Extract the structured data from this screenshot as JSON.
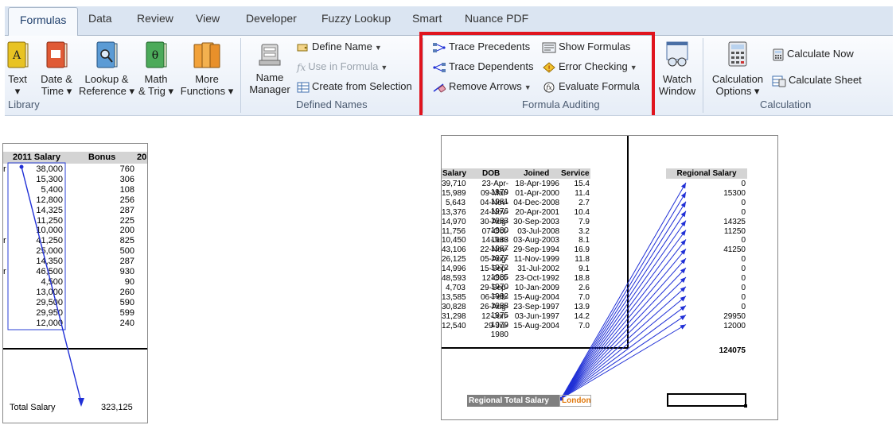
{
  "ribbon": {
    "tabs": [
      "Formulas",
      "Data",
      "Review",
      "View",
      "Developer",
      "Fuzzy Lookup",
      "Smart",
      "Nuance PDF"
    ],
    "library": {
      "group_label": "Library",
      "buttons": [
        {
          "line1": "Text",
          "line2": "▾"
        },
        {
          "line1": "Date &",
          "line2": "Time ▾"
        },
        {
          "line1": "Lookup &",
          "line2": "Reference ▾"
        },
        {
          "line1": "Math",
          "line2": "& Trig ▾"
        },
        {
          "line1": "More",
          "line2": "Functions ▾"
        }
      ]
    },
    "defined_names": {
      "group_label": "Defined Names",
      "name_manager": {
        "line1": "Name",
        "line2": "Manager"
      },
      "define_name": "Define Name",
      "use_in_formula": "Use in Formula",
      "create_from_selection": "Create from Selection"
    },
    "formula_auditing": {
      "group_label": "Formula Auditing",
      "trace_precedents": "Trace Precedents",
      "trace_dependents": "Trace Dependents",
      "remove_arrows": "Remove Arrows",
      "show_formulas": "Show Formulas",
      "error_checking": "Error Checking",
      "evaluate_formula": "Evaluate Formula"
    },
    "watch_window": {
      "line1": "Watch",
      "line2": "Window"
    },
    "calculation": {
      "group_label": "Calculation",
      "options": {
        "line1": "Calculation",
        "line2": "Options ▾"
      },
      "calculate_now": "Calculate Now",
      "calculate_sheet": "Calculate Sheet"
    },
    "accent_color": "#e0141e"
  },
  "left_sheet": {
    "headers": {
      "salary": "2011 Salary",
      "bonus": "Bonus",
      "extra": "20"
    },
    "rows": [
      {
        "mark": "r",
        "salary": "38,000",
        "bonus": "760"
      },
      {
        "mark": "",
        "salary": "15,300",
        "bonus": "306"
      },
      {
        "mark": "",
        "salary": "5,400",
        "bonus": "108"
      },
      {
        "mark": "",
        "salary": "12,800",
        "bonus": "256"
      },
      {
        "mark": "",
        "salary": "14,325",
        "bonus": "287"
      },
      {
        "mark": "",
        "salary": "11,250",
        "bonus": "225"
      },
      {
        "mark": "",
        "salary": "10,000",
        "bonus": "200"
      },
      {
        "mark": "r",
        "salary": "41,250",
        "bonus": "825"
      },
      {
        "mark": "",
        "salary": "25,000",
        "bonus": "500"
      },
      {
        "mark": "",
        "salary": "14,350",
        "bonus": "287"
      },
      {
        "mark": "r",
        "salary": "46,500",
        "bonus": "930"
      },
      {
        "mark": "",
        "salary": "4,500",
        "bonus": "90"
      },
      {
        "mark": "",
        "salary": "13,000",
        "bonus": "260"
      },
      {
        "mark": "",
        "salary": "29,500",
        "bonus": "590"
      },
      {
        "mark": "",
        "salary": "29,950",
        "bonus": "599"
      },
      {
        "mark": "",
        "salary": "12,000",
        "bonus": "240"
      }
    ],
    "total_label": "Total Salary",
    "total_value": "323,125"
  },
  "right_sheet": {
    "headers": {
      "salary": "Salary",
      "dob": "DOB",
      "joined": "Joined",
      "service": "Service",
      "regional": "Regional Salary"
    },
    "rows": [
      {
        "salary": "39,710",
        "dob": "23-Apr-1979",
        "joined": "18-Apr-1996",
        "service": "15.4",
        "regional": "0"
      },
      {
        "salary": "15,989",
        "dob": "09-Mar-1981",
        "joined": "01-Apr-2000",
        "service": "11.4",
        "regional": "15300"
      },
      {
        "salary": "5,643",
        "dob": "04-Nov-1976",
        "joined": "04-Dec-2008",
        "service": "2.7",
        "regional": "0"
      },
      {
        "salary": "13,376",
        "dob": "24-Nov-1983",
        "joined": "20-Apr-2001",
        "service": "10.4",
        "regional": "0"
      },
      {
        "salary": "14,970",
        "dob": "30-Aug-1980",
        "joined": "30-Sep-2003",
        "service": "7.9",
        "regional": "14325"
      },
      {
        "salary": "11,756",
        "dob": "07-Oct-1983",
        "joined": "03-Jul-2008",
        "service": "3.2",
        "regional": "11250"
      },
      {
        "salary": "10,450",
        "dob": "14-Jun-1987",
        "joined": "03-Aug-2003",
        "service": "8.1",
        "regional": "0"
      },
      {
        "salary": "43,106",
        "dob": "22-Nov-1977",
        "joined": "29-Sep-1994",
        "service": "16.9",
        "regional": "41250"
      },
      {
        "salary": "26,125",
        "dob": "05-Aug-1972",
        "joined": "11-Nov-1999",
        "service": "11.8",
        "regional": "0"
      },
      {
        "salary": "14,996",
        "dob": "15-Sep-1985",
        "joined": "31-Jul-2002",
        "service": "9.1",
        "regional": "0"
      },
      {
        "salary": "48,593",
        "dob": "12-Oct-1970",
        "joined": "23-Oct-1992",
        "service": "18.8",
        "regional": "0"
      },
      {
        "salary": "4,703",
        "dob": "29-Sep-1982",
        "joined": "10-Jan-2009",
        "service": "2.6",
        "regional": "0"
      },
      {
        "salary": "13,585",
        "dob": "06-Feb-1988",
        "joined": "15-Aug-2004",
        "service": "7.0",
        "regional": "0"
      },
      {
        "salary": "30,828",
        "dob": "26-Aug-1975",
        "joined": "23-Sep-1997",
        "service": "13.9",
        "regional": "0"
      },
      {
        "salary": "31,298",
        "dob": "12-Jun-1979",
        "joined": "03-Jun-1997",
        "service": "14.2",
        "regional": "29950"
      },
      {
        "salary": "12,540",
        "dob": "29-Jul-1980",
        "joined": "15-Aug-2004",
        "service": "7.0",
        "regional": "12000"
      }
    ],
    "regional_total": "124075",
    "regional_total_label": "Regional Total Salary",
    "region_value": "London",
    "arrow_color": "#1f2fd6"
  }
}
